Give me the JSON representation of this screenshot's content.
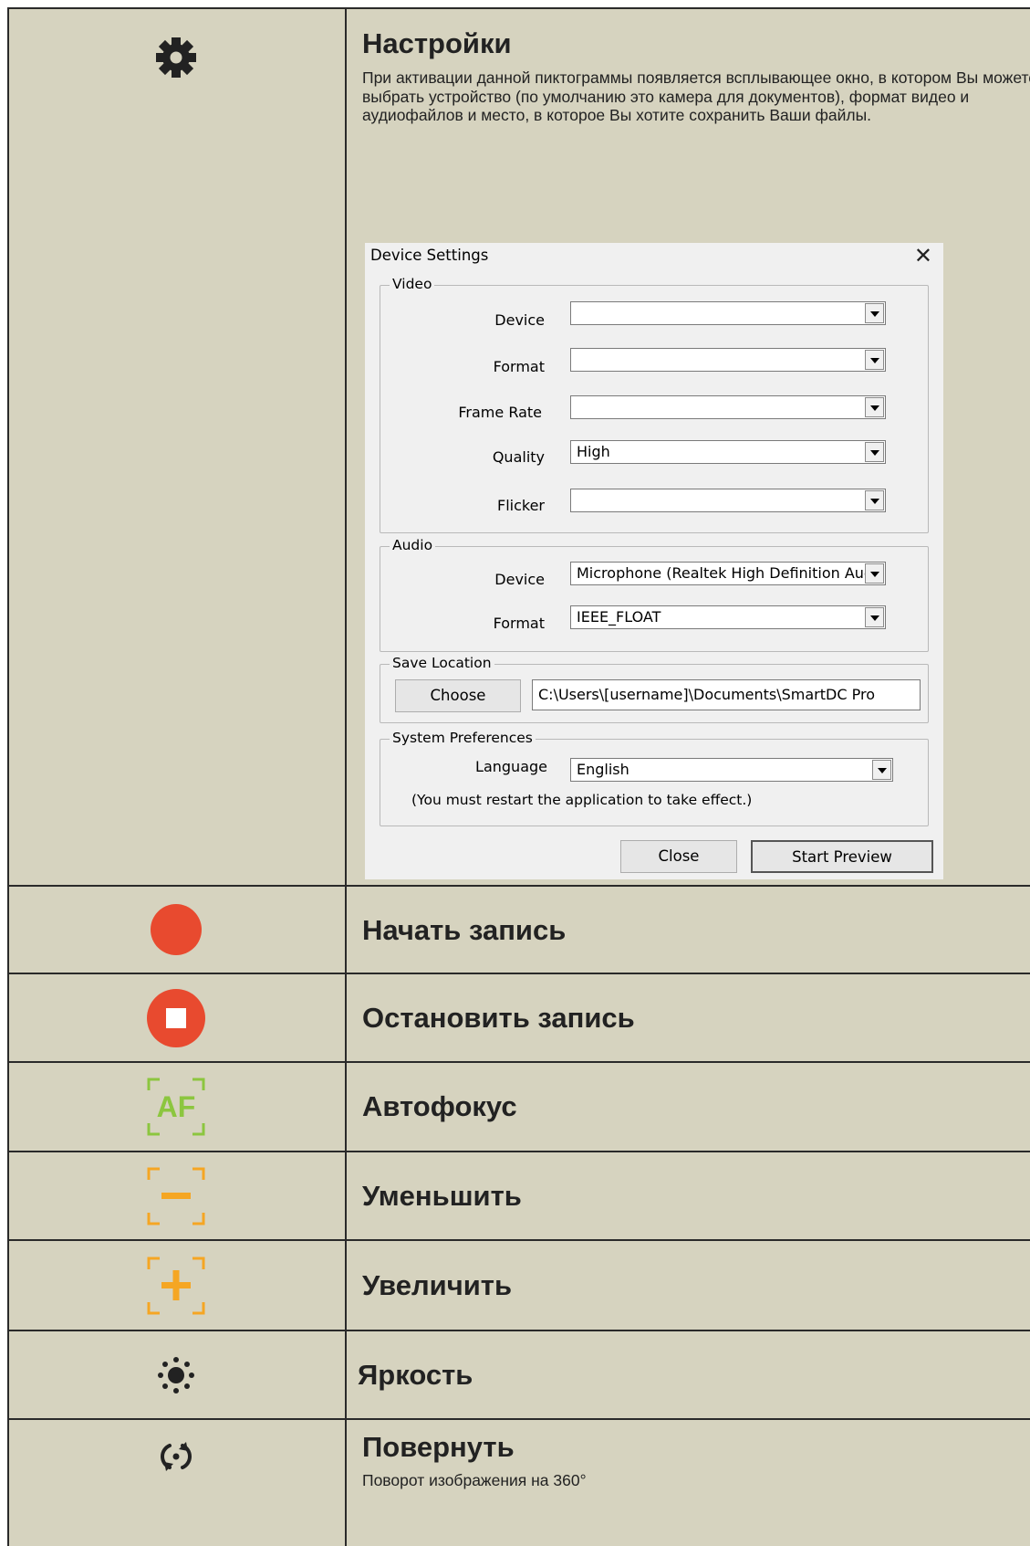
{
  "rows": {
    "settings": {
      "title": "Настройки",
      "description": "При активации данной пиктограммы появляется всплывающее окно, в котором Вы можете выбрать устройство (по умолчанию это камера для документов), формат видео и аудиофайлов и место, в которое Вы хотите сохранить Ваши файлы."
    },
    "start_record": {
      "title": "Начать запись"
    },
    "stop_record": {
      "title": "Остановить запись"
    },
    "autofocus": {
      "title": "Автофокус",
      "icon_text": "AF"
    },
    "zoom_out": {
      "title": "Уменьшить"
    },
    "zoom_in": {
      "title": "Увеличить"
    },
    "brightness": {
      "title": "Яркость"
    },
    "rotate": {
      "title": "Повернуть",
      "description": "Поворот изображения на 360°"
    }
  },
  "dialog": {
    "title": "Device Settings",
    "video": {
      "group_label": "Video",
      "device_label": "Device",
      "device_value": "",
      "format_label": "Format",
      "format_value": "",
      "frame_rate_label": "Frame Rate",
      "frame_rate_value": "",
      "quality_label": "Quality",
      "quality_value": "High",
      "flicker_label": "Flicker",
      "flicker_value": ""
    },
    "audio": {
      "group_label": "Audio",
      "device_label": "Device",
      "device_value": "Microphone (Realtek High Definition Auc",
      "format_label": "Format",
      "format_value": "IEEE_FLOAT"
    },
    "save_location": {
      "group_label": "Save Location",
      "choose_label": "Choose",
      "path": "C:\\Users\\[username]\\Documents\\SmartDC Pro"
    },
    "system_preferences": {
      "group_label": "System Preferences",
      "language_label": "Language",
      "language_value": "English",
      "note": "(You must restart the application to take effect.)"
    },
    "close_label": "Close",
    "start_preview_label": "Start Preview"
  },
  "colors": {
    "table_bg": "#d6d3bf",
    "record_red": "#e84a2f",
    "af_green": "#8cc63f",
    "zoom_orange": "#f5a623"
  },
  "icons": [
    "gear-icon",
    "record-icon",
    "stop-icon",
    "autofocus-icon",
    "zoom-out-icon",
    "zoom-in-icon",
    "brightness-icon",
    "rotate-icon"
  ]
}
